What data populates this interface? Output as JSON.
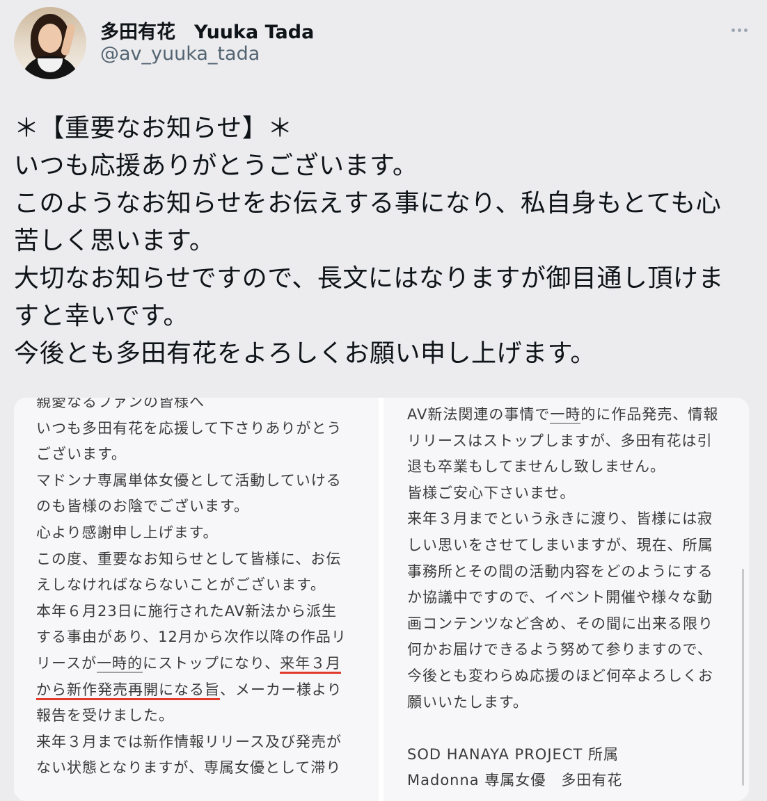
{
  "author": {
    "name": "多田有花　Yuuka Tada",
    "handle": "@av_yuuka_tada"
  },
  "more_icon": "more-horizontal-icon",
  "tweet": {
    "lines": [
      "＊【重要なお知らせ】＊",
      "いつも応援ありがとうございます。",
      "このようなお知らせをお伝えする事になり、私自身もとても心",
      "苦しく思います。",
      "大切なお知らせですので、長文にはなりますが御目通し頂けま",
      "すと幸いです。",
      "今後とも多田有花をよろしくお願い申し上げます。"
    ]
  },
  "letter_left": {
    "lines": [
      "親愛なるファンの皆様へ",
      "いつも多田有花を応援して下さりありがとう",
      "ございます。",
      "マドンナ専属単体女優として活動していける",
      "のも皆様のお陰でございます。",
      "心より感謝申し上げます。",
      "この度、重要なお知らせとして皆様に、お伝",
      "えしなければならないことがございます。",
      "本年６月23日に施行されたAV新法から派生",
      "する事由があり、12月から次作以降の作品リ",
      "リースが",
      "一時的",
      "にストップになり、",
      "来年３月",
      "から新作発売再開になる旨",
      "、メーカー様より",
      "報告を受けました。",
      "来年３月までは新作情報リリース及び発売が",
      "ない状態となりますが、専属女優として滞り"
    ]
  },
  "letter_right": {
    "lines": [
      "AV新法関連の事情で",
      "一時",
      "的に作品発売、情報",
      "リリースはストップしますが、多田有花は引",
      "退も卒業もしてませんし致しません。",
      "皆様ご安心下さいませ。",
      "来年３月までという永きに渡り、皆様には寂",
      "しい思いをさせてしまいますが、現在、所属",
      "事務所とその間の活動内容をどのようにする",
      "か協議中ですので、イベント開催や様々な動",
      "画コンテンツなど含め、その間に出来る限り",
      "何かお届けできるよう努めて参りますので、",
      "今後とも変わらぬ応援のほど何卒よろしくお",
      "願いいたします。",
      "SOD HANAYA PROJECT 所属",
      "Madonna 専属女優　多田有花"
    ]
  },
  "colors": {
    "background": "#ececef",
    "text": "#0f1419",
    "secondary": "#536471",
    "underline": "#e03a2a"
  }
}
